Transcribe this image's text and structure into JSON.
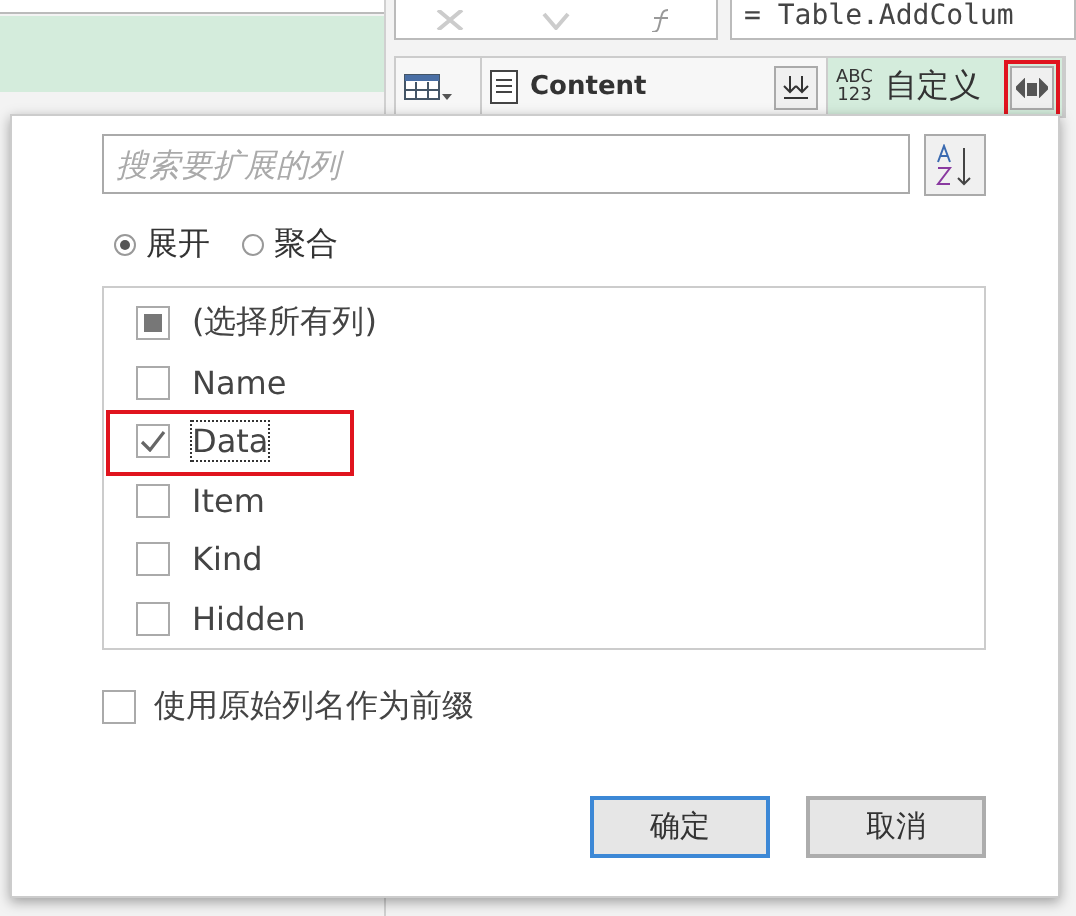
{
  "formula_bar": {
    "formula": "= Table.AddColum"
  },
  "columns": [
    {
      "kind": "table-menu"
    },
    {
      "kind": "text",
      "label": "Content"
    },
    {
      "kind": "any",
      "type_label": "ABC\n123",
      "label": "自定义",
      "highlighted": true
    }
  ],
  "dialog": {
    "search": {
      "placeholder": "搜索要扩展的列"
    },
    "modes": [
      {
        "label": "展开",
        "selected": true
      },
      {
        "label": "聚合",
        "selected": false
      }
    ],
    "items": [
      {
        "label": "(选择所有列)",
        "checked": false,
        "partial": true,
        "focused": false,
        "highlighted": false
      },
      {
        "label": "Name",
        "checked": false,
        "partial": false,
        "focused": false,
        "highlighted": false
      },
      {
        "label": "Data",
        "checked": true,
        "partial": false,
        "focused": true,
        "highlighted": true
      },
      {
        "label": "Item",
        "checked": false,
        "partial": false,
        "focused": false,
        "highlighted": false
      },
      {
        "label": "Kind",
        "checked": false,
        "partial": false,
        "focused": false,
        "highlighted": false
      },
      {
        "label": "Hidden",
        "checked": false,
        "partial": false,
        "focused": false,
        "highlighted": false
      }
    ],
    "prefix": {
      "label": "使用原始列名作为前缀",
      "checked": false
    },
    "buttons": [
      {
        "label": "确定",
        "primary": true
      },
      {
        "label": "取消",
        "primary": false
      }
    ]
  }
}
